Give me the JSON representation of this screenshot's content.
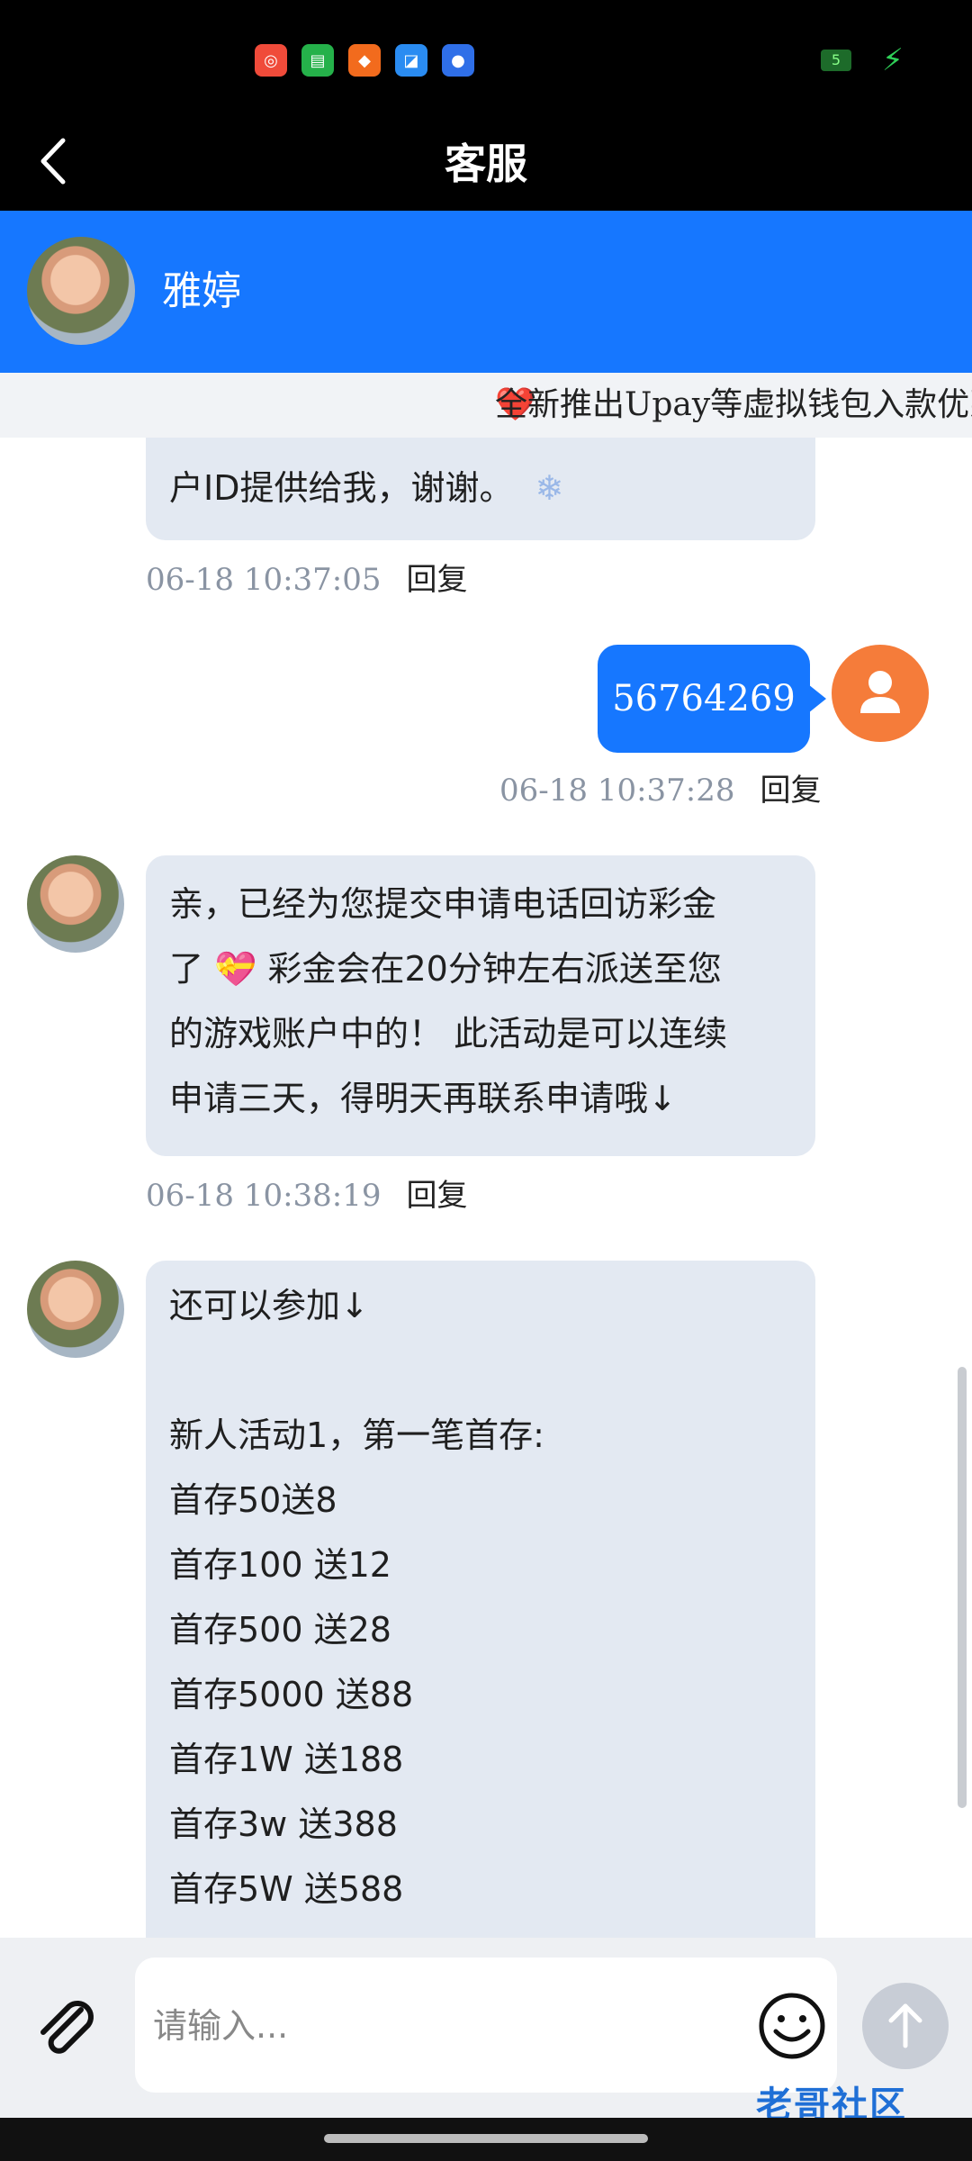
{
  "app": {
    "title": "客服",
    "agent_name": "雅婷",
    "marquee": "全新推出Upay等虚拟钱包入款优惠，笔笔加"
  },
  "colors": {
    "primary": "#1677ff",
    "bubble_left": "#e3e9f2",
    "user_avatar": "#f57c3a"
  },
  "messages": [
    {
      "side": "left",
      "text": "户ID提供给我，谢谢。",
      "emoji": "❄",
      "time": "06-18 10:37:05",
      "reply": "回复"
    },
    {
      "side": "right",
      "text": "56764269",
      "time": "06-18 10:37:28",
      "reply": "回复"
    },
    {
      "side": "left",
      "lines": [
        "亲，已经为您提交申请电话回访彩金",
        "了 💝 彩金会在20分钟左右派送至您",
        "的游戏账户中的！ 此活动是可以连续",
        "申请三天，得明天再联系申请哦↓"
      ],
      "time": "06-18 10:38:19",
      "reply": "回复"
    },
    {
      "side": "left",
      "lines": [
        "还可以参加↓",
        "",
        "新人活动1，第一笔首存:",
        "首存50送8",
        "首存100 送12",
        "首存500 送28",
        "首存5000 送88",
        "首存1W 送188",
        "首存3w 送388",
        "首存5W 送588"
      ]
    }
  ],
  "input": {
    "placeholder": "请输入..."
  },
  "watermark": "老哥社区"
}
